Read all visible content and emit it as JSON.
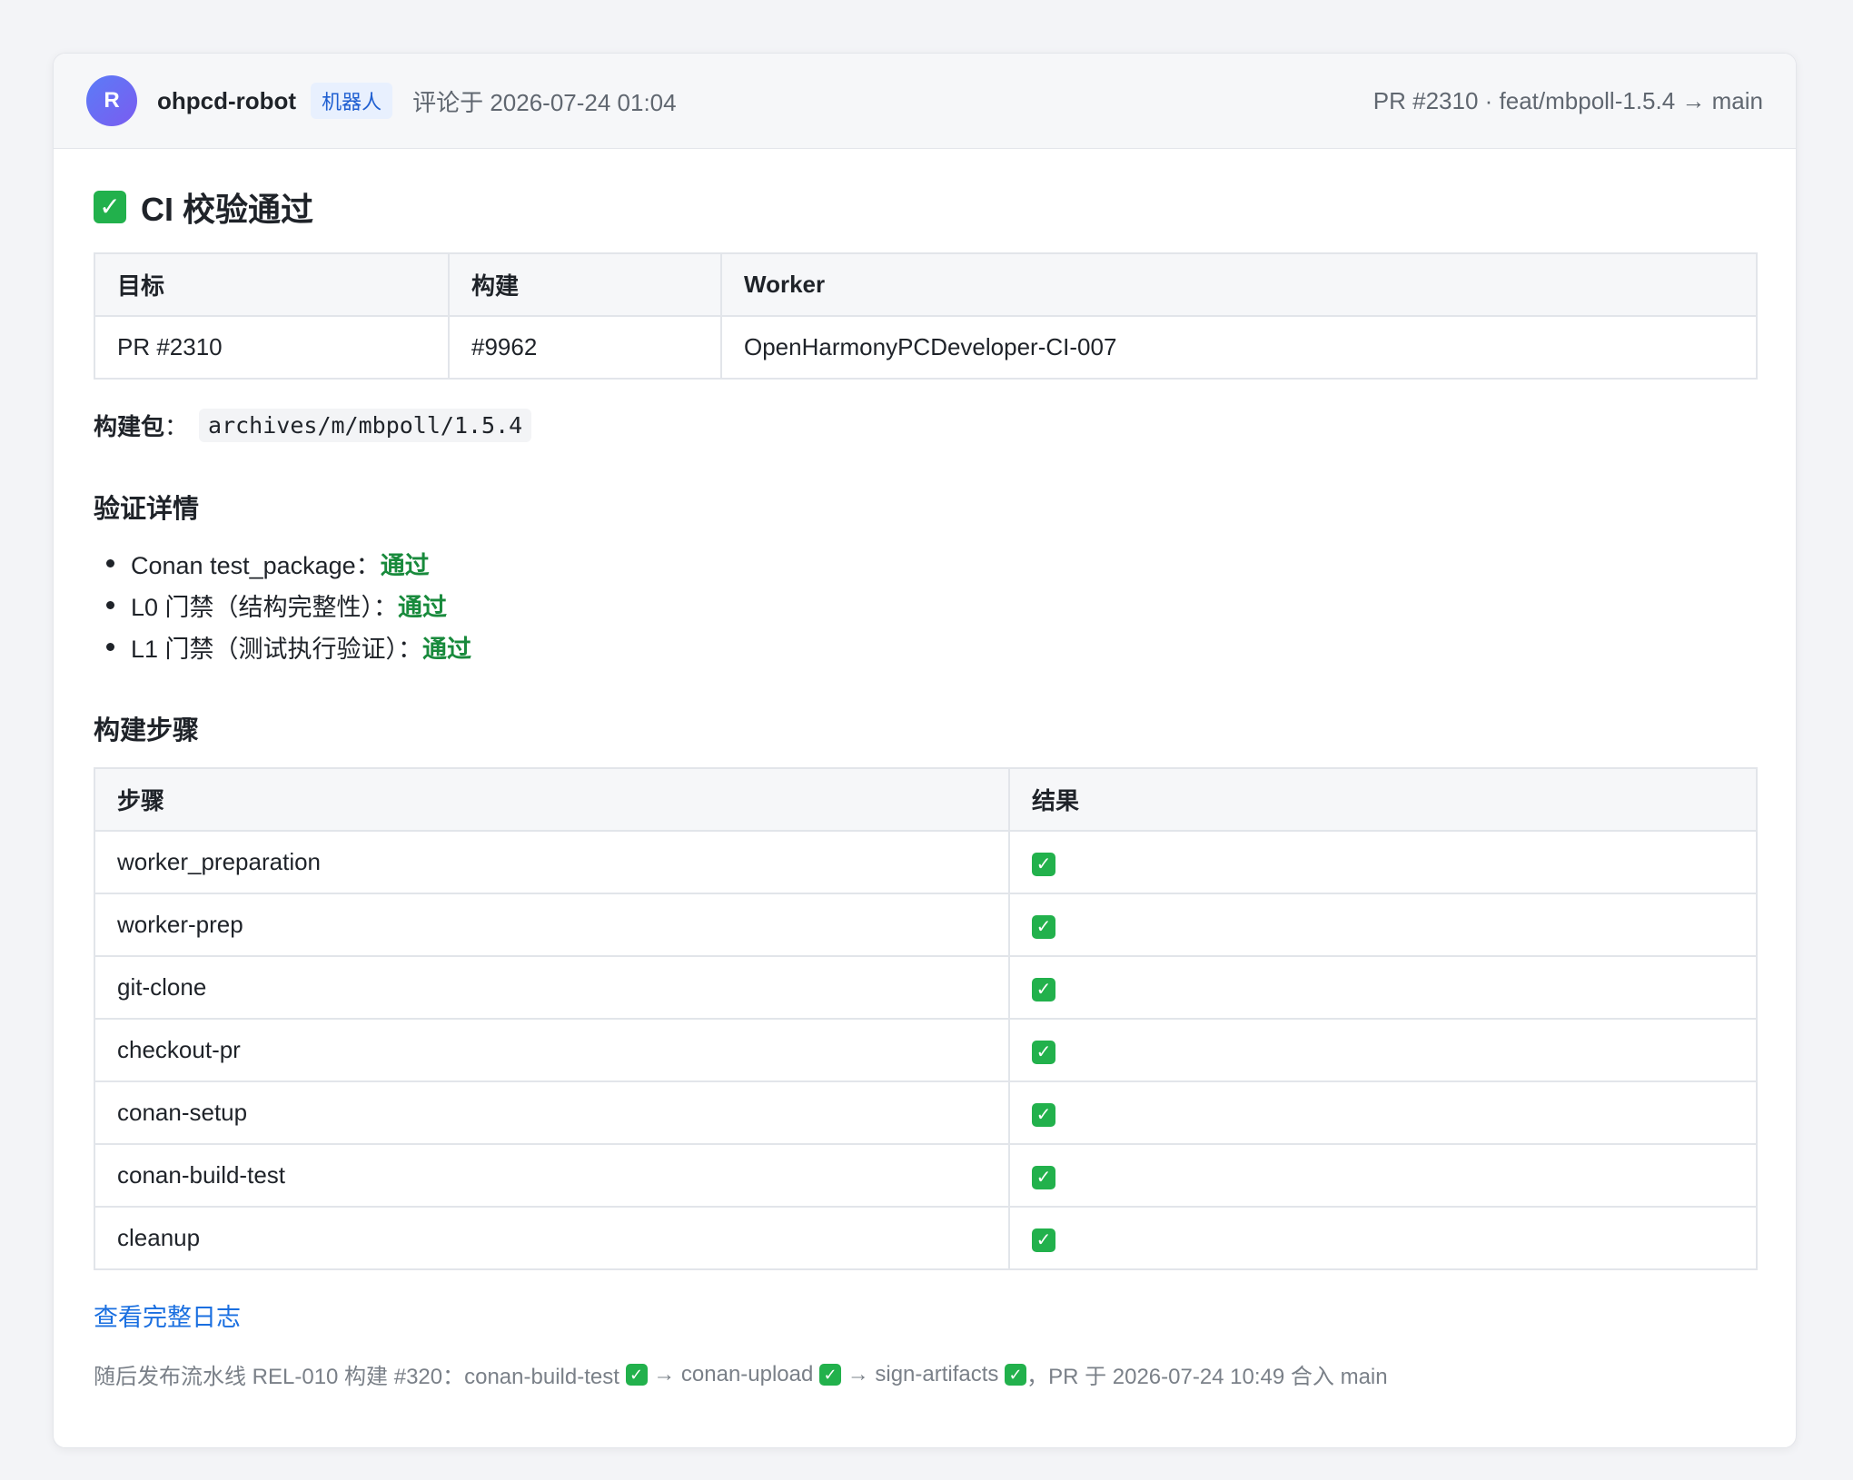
{
  "header": {
    "avatar_letter": "R",
    "author": "ohpcd-robot",
    "badge": "机器人",
    "comment_meta": "评论于 2026-07-24 01:04",
    "pr_info": "PR #2310 · feat/mbpoll-1.5.4 → main"
  },
  "title": {
    "icon": "check-mark-icon",
    "text": "CI 校验通过"
  },
  "summary_table": {
    "headers": [
      "目标",
      "构建",
      "Worker"
    ],
    "rows": [
      [
        "PR #2310",
        "#9962",
        "OpenHarmonyPCDeveloper-CI-007"
      ]
    ]
  },
  "package": {
    "label": "构建包",
    "colon": "：",
    "path": "archives/m/mbpoll/1.5.4"
  },
  "details": {
    "heading": "验证详情",
    "items": [
      {
        "label": "Conan test_package：",
        "status": "通过"
      },
      {
        "label": "L0 门禁（结构完整性）：",
        "status": "通过"
      },
      {
        "label": "L1 门禁（测试执行验证）：",
        "status": "通过"
      }
    ]
  },
  "steps": {
    "heading": "构建步骤",
    "headers": [
      "步骤",
      "结果"
    ],
    "rows": [
      {
        "step": "worker_preparation",
        "result": "✓"
      },
      {
        "step": "worker-prep",
        "result": "✓"
      },
      {
        "step": "git-clone",
        "result": "✓"
      },
      {
        "step": "checkout-pr",
        "result": "✓"
      },
      {
        "step": "conan-setup",
        "result": "✓"
      },
      {
        "step": "conan-build-test",
        "result": "✓"
      },
      {
        "step": "cleanup",
        "result": "✓"
      }
    ]
  },
  "log_link": "查看完整日志",
  "footer": {
    "prefix": "随后发布流水线 REL-010 构建 #320：conan-build-test ",
    "seg2": " → conan-upload ",
    "seg3": " → sign-artifacts ",
    "suffix": "，PR 于 2026-07-24 10:49 合入 main"
  },
  "colors": {
    "accent": "#1a6fe0",
    "pass_green": "#188a3c",
    "check_bg": "#22b14c",
    "badge_bg": "#e8f0fe"
  }
}
